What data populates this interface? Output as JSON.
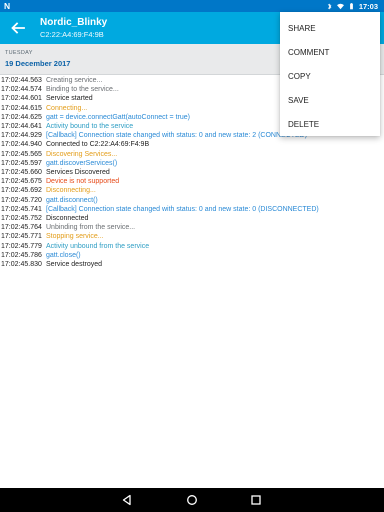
{
  "status_bar": {
    "app_icon": "N",
    "time": "17:03",
    "icons": [
      "bluetooth-icon",
      "wifi-icon",
      "battery-icon"
    ]
  },
  "app_bar": {
    "title": "Nordic_Blinky",
    "subtitle": "C2:22:A4:69:F4:9B",
    "back_icon": "arrow-left-icon",
    "bg_color": "#00a9e0",
    "status_bg_color": "#0077c8"
  },
  "date_header": {
    "day": "TUESDAY",
    "date": "19 December 2017"
  },
  "log": [
    {
      "time": "17:02:44.563",
      "message": "Creating service...",
      "level": "verbose"
    },
    {
      "time": "17:02:44.574",
      "message": "Binding to the service...",
      "level": "verbose"
    },
    {
      "time": "17:02:44.601",
      "message": "Service started",
      "level": "info"
    },
    {
      "time": "17:02:44.615",
      "message": "Connecting...",
      "level": "warn"
    },
    {
      "time": "17:02:44.625",
      "message": "gatt = device.connectGatt(autoConnect = true)",
      "level": "debug"
    },
    {
      "time": "17:02:44.641",
      "message": "Activity bound to the service",
      "level": "app"
    },
    {
      "time": "17:02:44.929",
      "message": "[Callback] Connection state changed with status: 0 and new state: 2 (CONNECTED)",
      "level": "debug"
    },
    {
      "time": "17:02:44.940",
      "message": "Connected to C2:22:A4:69:F4:9B",
      "level": "info"
    },
    {
      "time": "17:02:45.565",
      "message": "Discovering Services...",
      "level": "warn"
    },
    {
      "time": "17:02:45.597",
      "message": "gatt.discoverServices()",
      "level": "debug"
    },
    {
      "time": "17:02:45.660",
      "message": "Services Discovered",
      "level": "info"
    },
    {
      "time": "17:02:45.675",
      "message": "Device is not supported",
      "level": "error"
    },
    {
      "time": "17:02:45.692",
      "message": "Disconnecting...",
      "level": "warn"
    },
    {
      "time": "17:02:45.720",
      "message": "gatt.disconnect()",
      "level": "debug"
    },
    {
      "time": "17:02:45.741",
      "message": "[Callback] Connection state changed with status: 0 and new state: 0 (DISCONNECTED)",
      "level": "debug"
    },
    {
      "time": "17:02:45.752",
      "message": "Disconnected",
      "level": "info"
    },
    {
      "time": "17:02:45.764",
      "message": "Unbinding from the service...",
      "level": "verbose"
    },
    {
      "time": "17:02:45.771",
      "message": "Stopping service...",
      "level": "warn"
    },
    {
      "time": "17:02:45.779",
      "message": "Activity unbound from the service",
      "level": "app"
    },
    {
      "time": "17:02:45.786",
      "message": "gatt.close()",
      "level": "debug"
    },
    {
      "time": "17:02:45.830",
      "message": "Service destroyed",
      "level": "info"
    }
  ],
  "overflow_menu": {
    "items": [
      "SHARE",
      "COMMENT",
      "COPY",
      "SAVE",
      "DELETE"
    ]
  },
  "nav_bar": {
    "buttons": [
      "back-nav-icon",
      "home-nav-icon",
      "recents-nav-icon"
    ]
  }
}
